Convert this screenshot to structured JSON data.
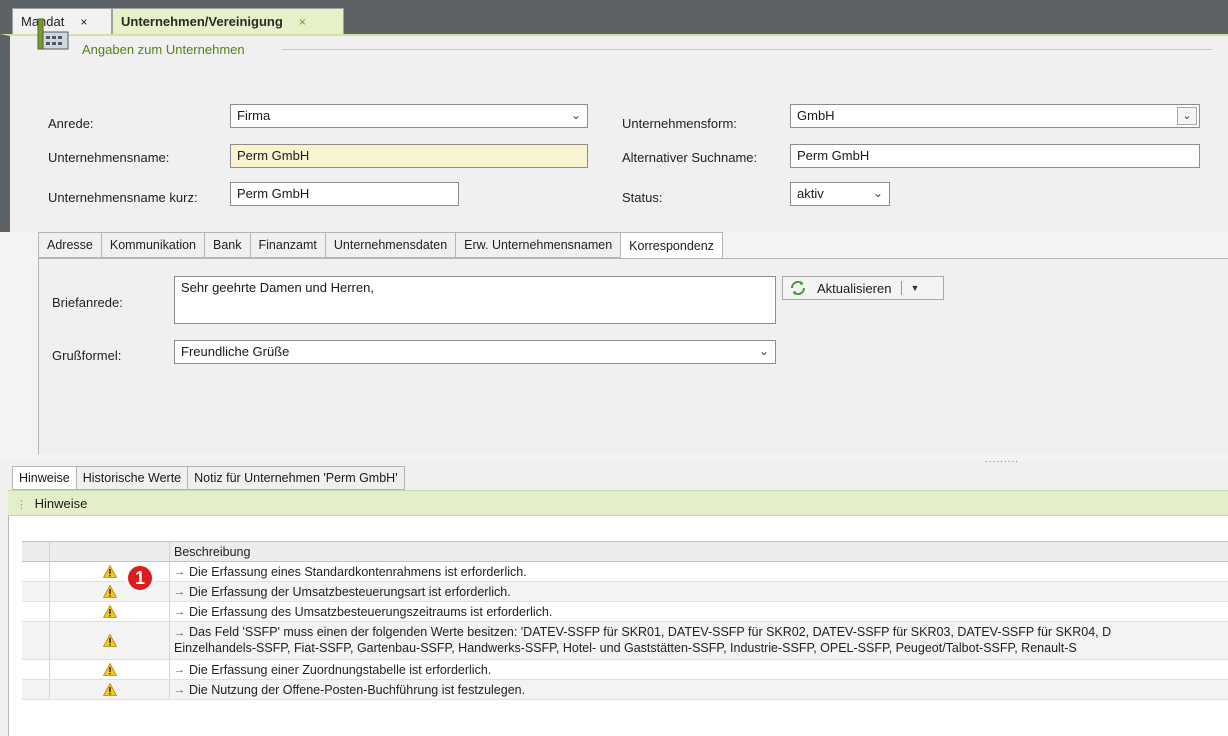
{
  "doc_tabs": [
    {
      "label": "Mandat",
      "close": "×"
    },
    {
      "label": "Unternehmen/Vereinigung",
      "close": "×"
    }
  ],
  "section": {
    "title": "Angaben zum Unternehmen"
  },
  "form": {
    "anrede_label": "Anrede:",
    "anrede_value": "Firma",
    "name_label": "Unternehmensname:",
    "name_value": "Perm GmbH",
    "short_label": "Unternehmensname kurz:",
    "short_value": "Perm GmbH",
    "form_label": "Unternehmensform:",
    "form_value": "GmbH",
    "alt_label": "Alternativer Suchname:",
    "alt_value": "Perm GmbH",
    "status_label": "Status:",
    "status_value": "aktiv"
  },
  "sub_tabs": [
    "Adresse",
    "Kommunikation",
    "Bank",
    "Finanzamt",
    "Unternehmensdaten",
    "Erw. Unternehmensnamen",
    "Korrespondenz"
  ],
  "active_sub_tab": "Korrespondenz",
  "korrespondenz": {
    "briefanrede_label": "Briefanrede:",
    "briefanrede_value": "Sehr geehrte Damen und Herren,",
    "grussformel_label": "Grußformel:",
    "grussformel_value": "Freundliche Grüße",
    "update_button": "Aktualisieren"
  },
  "bottom_tabs": [
    "Hinweise",
    "Historische Werte",
    "Notiz für Unternehmen 'Perm GmbH'"
  ],
  "hinweise_title": "Hinweise",
  "notes": {
    "column_header": "Beschreibung",
    "callout": "1",
    "rows": [
      {
        "line1": "Die Erfassung eines Standardkontenrahmens ist erforderlich.",
        "line2": ""
      },
      {
        "line1": "Die Erfassung der Umsatzbesteuerungsart ist erforderlich.",
        "line2": ""
      },
      {
        "line1": "Die Erfassung des Umsatzbesteuerungszeitraums ist erforderlich.",
        "line2": ""
      },
      {
        "line1": "Das Feld 'SSFP' muss einen der folgenden Werte besitzen: 'DATEV-SSFP für SKR01, DATEV-SSFP für SKR02, DATEV-SSFP für SKR03, DATEV-SSFP für SKR04, D",
        "line2": "Einzelhandels-SSFP, Fiat-SSFP, Gartenbau-SSFP, Handwerks-SSFP, Hotel- und Gaststätten-SSFP, Industrie-SSFP, OPEL-SSFP, Peugeot/Talbot-SSFP, Renault-S"
      },
      {
        "line1": "Die Erfassung einer Zuordnungstabelle ist erforderlich.",
        "line2": ""
      },
      {
        "line1": "Die Nutzung der Offene-Posten-Buchführung ist festzulegen.",
        "line2": ""
      }
    ]
  },
  "colors": {
    "accent_green": "#5a7e1c",
    "tab_active": "#e7f1c7",
    "highlight_field": "#faf3cf",
    "warning": "#f3c622",
    "callout": "#e01b1b"
  },
  "icons": [
    "building-icon",
    "refresh-icon",
    "warning-icon",
    "chevron-down-icon",
    "close-icon"
  ]
}
